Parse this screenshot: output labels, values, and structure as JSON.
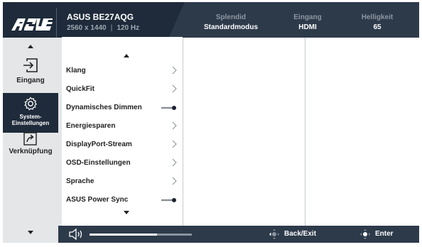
{
  "brand": {
    "logo": "ASUS"
  },
  "header": {
    "model": "ASUS BE27AQG",
    "resolution": "2560 x 1440",
    "refresh": "120 Hz",
    "stats": [
      {
        "label": "Splendid",
        "value": "Standardmodus"
      },
      {
        "label": "Eingang",
        "value": "HDMI"
      },
      {
        "label": "Helligkeit",
        "value": "65"
      }
    ]
  },
  "sidebar": {
    "items": [
      {
        "label": "Eingang",
        "icon": "input-icon",
        "active": false
      },
      {
        "label1": "System-",
        "label2": "Einstellungen",
        "icon": "gear-icon",
        "active": true
      },
      {
        "label": "Verknüpfung",
        "icon": "shortcut-icon",
        "active": false
      }
    ]
  },
  "menu": {
    "items": [
      {
        "label": "Klang",
        "control": "chevron"
      },
      {
        "label": "QuickFit",
        "control": "chevron"
      },
      {
        "label": "Dynamisches Dimmen",
        "control": "toggle",
        "on": true
      },
      {
        "label": "Energiesparen",
        "control": "chevron"
      },
      {
        "label": "DisplayPort-Stream",
        "control": "chevron"
      },
      {
        "label": "OSD-Einstellungen",
        "control": "chevron"
      },
      {
        "label": "Sprache",
        "control": "chevron"
      },
      {
        "label": "ASUS Power Sync",
        "control": "toggle",
        "on": true
      }
    ]
  },
  "footer": {
    "volume_level": 0.66,
    "back_label": "Back/Exit",
    "enter_label": "Enter"
  },
  "colors": {
    "header_bg": "#1f2b3a",
    "panel_bg": "#e4e6e8",
    "footer_bg": "#2d3a4a",
    "accent": "#1f2b3a"
  }
}
